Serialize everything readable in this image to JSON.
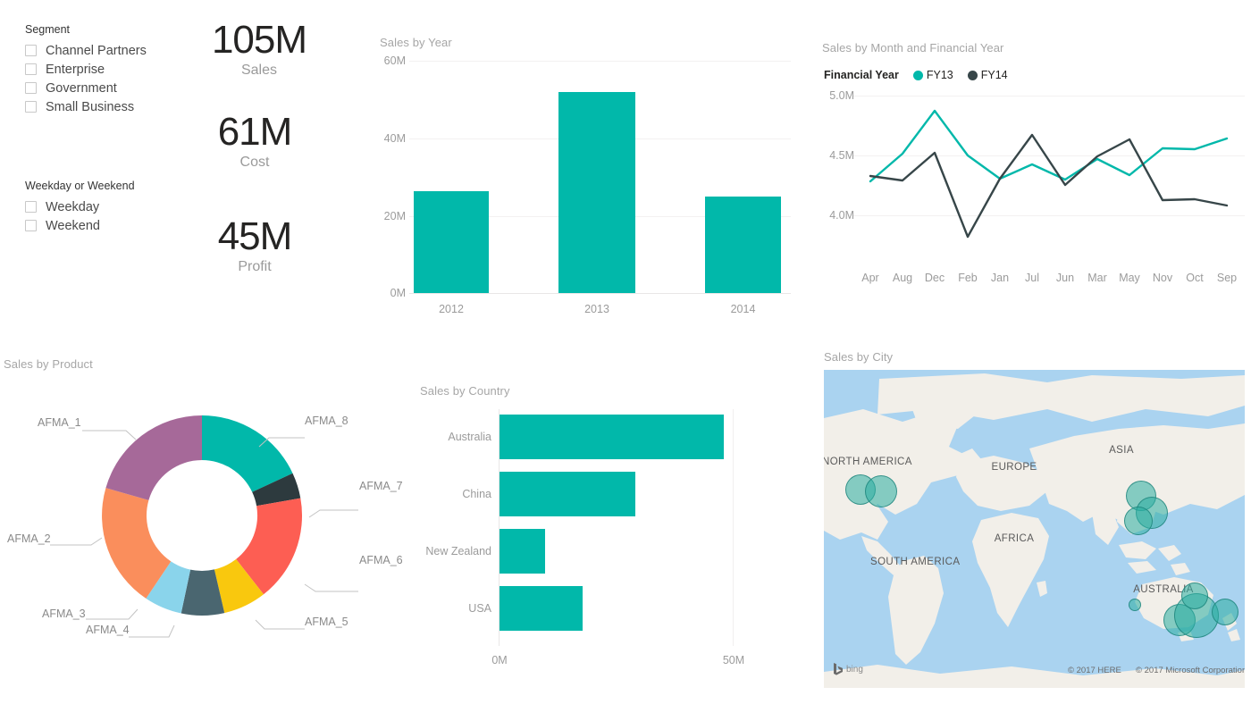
{
  "slicers": [
    {
      "title": "Segment",
      "items": [
        "Channel Partners",
        "Enterprise",
        "Government",
        "Small Business"
      ]
    },
    {
      "title": "Weekday or Weekend",
      "items": [
        "Weekday",
        "Weekend"
      ]
    }
  ],
  "kpis": [
    {
      "value": "105M",
      "label": "Sales"
    },
    {
      "value": "61M",
      "label": "Cost"
    },
    {
      "value": "45M",
      "label": "Profit"
    }
  ],
  "colors": {
    "teal": "#01B8AA",
    "dark": "#374649",
    "red": "#FD625E",
    "yellow": "#F2C80F",
    "slate": "#4A6670",
    "lightblue": "#8AD4EB",
    "orange": "#FE9666",
    "purple": "#A66999",
    "axis_text": "#9b9b9b",
    "title_text": "#a6a6a6"
  },
  "chart_data": [
    {
      "type": "bar",
      "title": "Sales by Year",
      "categories": [
        "2012",
        "2013",
        "2014"
      ],
      "values": [
        26.3,
        52.0,
        25.0
      ],
      "xlabel": "",
      "ylabel": "",
      "ylim": [
        0,
        60
      ],
      "yticks": [
        "0M",
        "20M",
        "40M",
        "60M"
      ],
      "grid": true,
      "legend": "none"
    },
    {
      "type": "line",
      "title": "Sales by Month and Financial Year",
      "legend_title": "Financial Year",
      "legend_position": "top",
      "categories": [
        "Apr",
        "Aug",
        "Dec",
        "Feb",
        "Jan",
        "Jul",
        "Jun",
        "Mar",
        "May",
        "Nov",
        "Oct",
        "Sep"
      ],
      "series": [
        {
          "name": "FY13",
          "color": "#01B8AA",
          "values": [
            4.28,
            4.51,
            4.87,
            4.5,
            4.31,
            4.43,
            4.3,
            4.47,
            4.34,
            4.56,
            4.55,
            4.64
          ]
        },
        {
          "name": "FY14",
          "color": "#374649",
          "values": [
            4.33,
            4.29,
            4.53,
            3.83,
            4.31,
            4.61,
            4.26,
            4.49,
            4.63,
            4.14,
            4.15,
            4.1
          ]
        }
      ],
      "ylim": [
        3.75,
        5.0
      ],
      "yticks": [
        "4.0M",
        "4.5M",
        "5.0M"
      ],
      "grid": true
    },
    {
      "type": "pie",
      "title": "Sales by Product",
      "donut": true,
      "labels": [
        "AFMA_8",
        "AFMA_7",
        "AFMA_6",
        "AFMA_5",
        "AFMA_4",
        "AFMA_3",
        "AFMA_2",
        "AFMA_1"
      ],
      "values": [
        18.0,
        4.0,
        17.0,
        7.0,
        7.0,
        6.0,
        20.0,
        21.0
      ],
      "slice_colors": [
        "#01B8AA",
        "#2D3A3E",
        "#FD5E53",
        "#F9C80E",
        "#4A6670",
        "#8AD4EB",
        "#FA8E5C",
        "#A66999"
      ]
    },
    {
      "type": "bar",
      "orientation": "horizontal",
      "title": "Sales by Country",
      "categories": [
        "Australia",
        "China",
        "New Zealand",
        "USA"
      ],
      "values": [
        48.0,
        29.0,
        9.8,
        17.8
      ],
      "xlim": [
        0,
        50
      ],
      "xticks": [
        "0M",
        "50M"
      ],
      "grid": false
    },
    {
      "type": "map",
      "title": "Sales by City",
      "continent_labels": [
        "NORTH AMERICA",
        "SOUTH AMERICA",
        "EUROPE",
        "AFRICA",
        "ASIA",
        "AUSTRALIA"
      ],
      "attribution": [
        "© 2017 HERE",
        "© 2017 Microsoft Corporation"
      ],
      "provider": "bing",
      "bubbles": [
        {
          "region": "North America - west",
          "size": 34
        },
        {
          "region": "North America - east",
          "size": 36
        },
        {
          "region": "Asia - north",
          "size": 34
        },
        {
          "region": "Asia - east",
          "size": 36
        },
        {
          "region": "Asia - south",
          "size": 32
        },
        {
          "region": "Australia - west",
          "size": 14
        },
        {
          "region": "Australia - south",
          "size": 36
        },
        {
          "region": "Australia - east",
          "size": 50
        },
        {
          "region": "Australia - north",
          "size": 30
        },
        {
          "region": "New Zealand",
          "size": 30
        }
      ]
    }
  ]
}
